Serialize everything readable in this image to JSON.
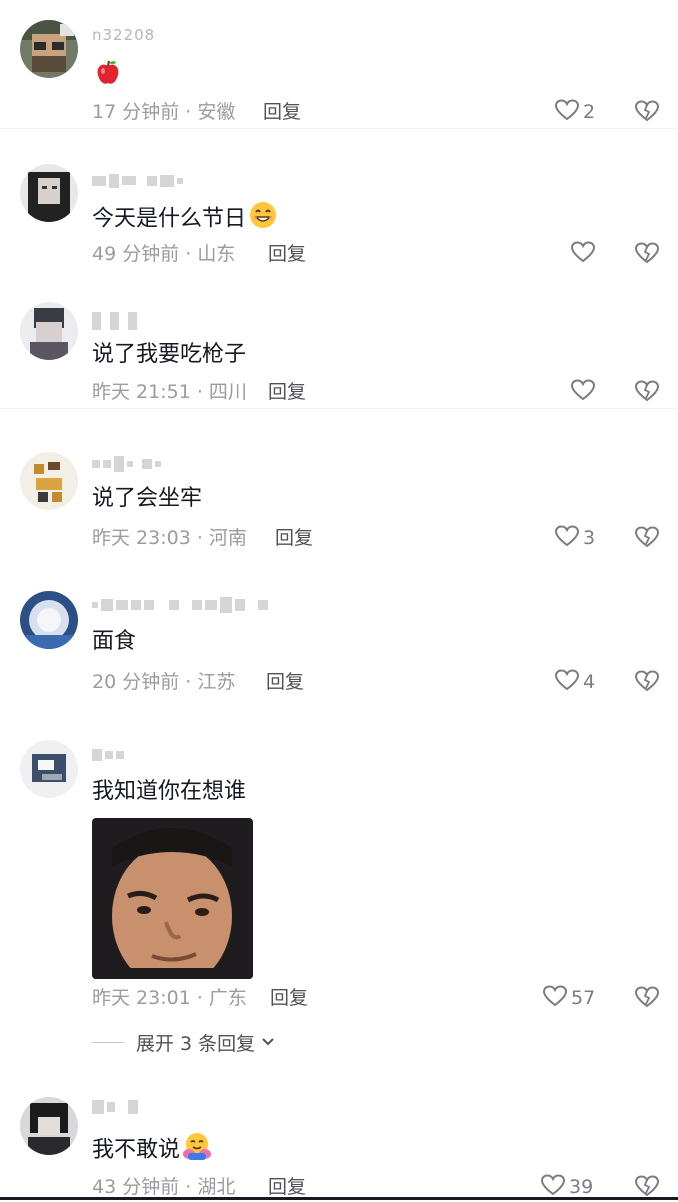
{
  "comments": [
    {
      "username": "n32208",
      "text": "",
      "emoji": "apple",
      "time": "17 分钟前 · 安徽",
      "reply_label": "回复",
      "like_count": "2"
    },
    {
      "username": "",
      "text": "今天是什么节日",
      "emoji": "grin",
      "time": "49 分钟前 · 山东",
      "reply_label": "回复",
      "like_count": ""
    },
    {
      "username": "",
      "text": "说了我要吃枪子",
      "emoji": "",
      "time": "昨天 21:51 · 四川",
      "reply_label": "回复",
      "like_count": ""
    },
    {
      "username": "",
      "text": "说了会坐牢",
      "emoji": "",
      "time": "昨天 23:03 · 河南",
      "reply_label": "回复",
      "like_count": "3"
    },
    {
      "username": "",
      "text": "面食",
      "emoji": "",
      "time": "20 分钟前 · 江苏",
      "reply_label": "回复",
      "like_count": "4"
    },
    {
      "username": "",
      "text": "我知道你在想谁",
      "emoji": "",
      "time": "昨天 23:01 · 广东",
      "reply_label": "回复",
      "like_count": "57",
      "expand_replies": "展开 3 条回复"
    },
    {
      "username": "",
      "text": "我不敢说",
      "emoji": "hug",
      "time": "43 分钟前 · 湖北",
      "reply_label": "回复",
      "like_count": "39"
    }
  ],
  "colors": {
    "text_primary": "#161823",
    "text_meta": "#9b9ba0",
    "reply_label": "#515156",
    "icon": "#7b7b80"
  }
}
